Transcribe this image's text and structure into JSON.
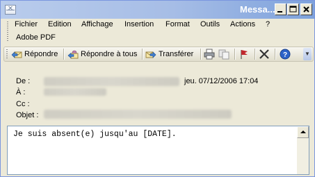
{
  "window": {
    "title": "Messa..."
  },
  "menu": {
    "items": [
      "Fichier",
      "Edition",
      "Affichage",
      "Insertion",
      "Format",
      "Outils",
      "Actions",
      "?"
    ],
    "second_row": "Adobe PDF"
  },
  "toolbar": {
    "reply": "Répondre",
    "reply_all": "Répondre à tous",
    "forward": "Transférer"
  },
  "header": {
    "from_label": "De :",
    "to_label": "À :",
    "cc_label": "Cc :",
    "subject_label": "Objet :",
    "date": "jeu. 07/12/2006 17:04"
  },
  "message": {
    "body": "Je suis absent(e) jusqu'au [DATE]."
  },
  "colors": {
    "title_gradient_end": "#7ea2dc",
    "window_bg": "#ece9d8",
    "flag": "#c0282d",
    "help_icon": "#2c62c8"
  }
}
